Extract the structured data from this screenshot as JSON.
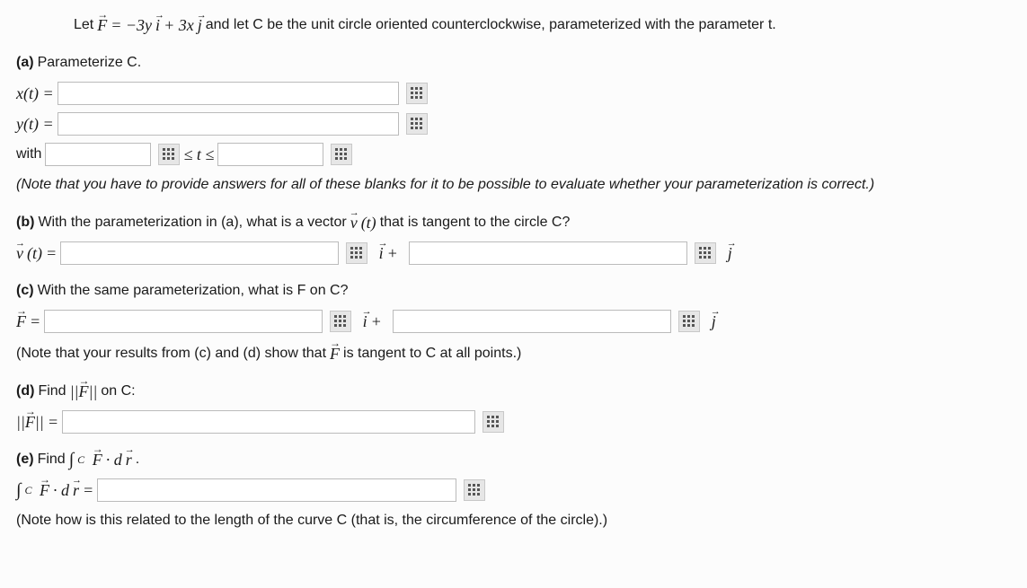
{
  "intro": {
    "prefix": "Let ",
    "eqF": "F",
    "eqText": " = −3y",
    "i": "i",
    "plus": " + 3x",
    "j": "j",
    "rest": " and let C be the unit circle oriented counterclockwise, parameterized with the parameter t."
  },
  "a": {
    "label": "(a)",
    "text": " Parameterize C.",
    "xt": "x(t) = ",
    "yt": "y(t) = ",
    "with": "with",
    "tle": " ≤ t ≤ ",
    "note": "(Note that you have to provide answers for all of these blanks for it to be possible to evaluate whether your parameterization is correct.)"
  },
  "b": {
    "label": "(b)",
    "text": " With the parameterization in (a), what is a vector ",
    "vt": "v",
    "paren": "(t)",
    "rest": " that is tangent to the circle C?",
    "eq": " = ",
    "iplus": "i",
    "plus": "+",
    "j": "j"
  },
  "c": {
    "label": "(c)",
    "text": " With the same parameterization, what is F on C?",
    "F": "F",
    "eq": " = ",
    "iplus": "i",
    "plus": "+",
    "j": "j"
  },
  "note_cd": "(Note that your results from (c) and (d) show that ",
  "note_cd_F": "F",
  "note_cd_rest": " is tangent to C at all points.)",
  "d": {
    "label": "(d)",
    "text": " Find ",
    "norm": "||F||",
    "onC": " on C:",
    "eq": " = "
  },
  "e": {
    "label": "(e)",
    "text": " Find ",
    "intpre": "∫",
    "sub": "C",
    "F": "F",
    "dot": " · d",
    "r": "r",
    "period": ".",
    "eq": " = ",
    "note": "(Note how is this related to the length of the curve C (that is, the circumference of the circle).)"
  }
}
